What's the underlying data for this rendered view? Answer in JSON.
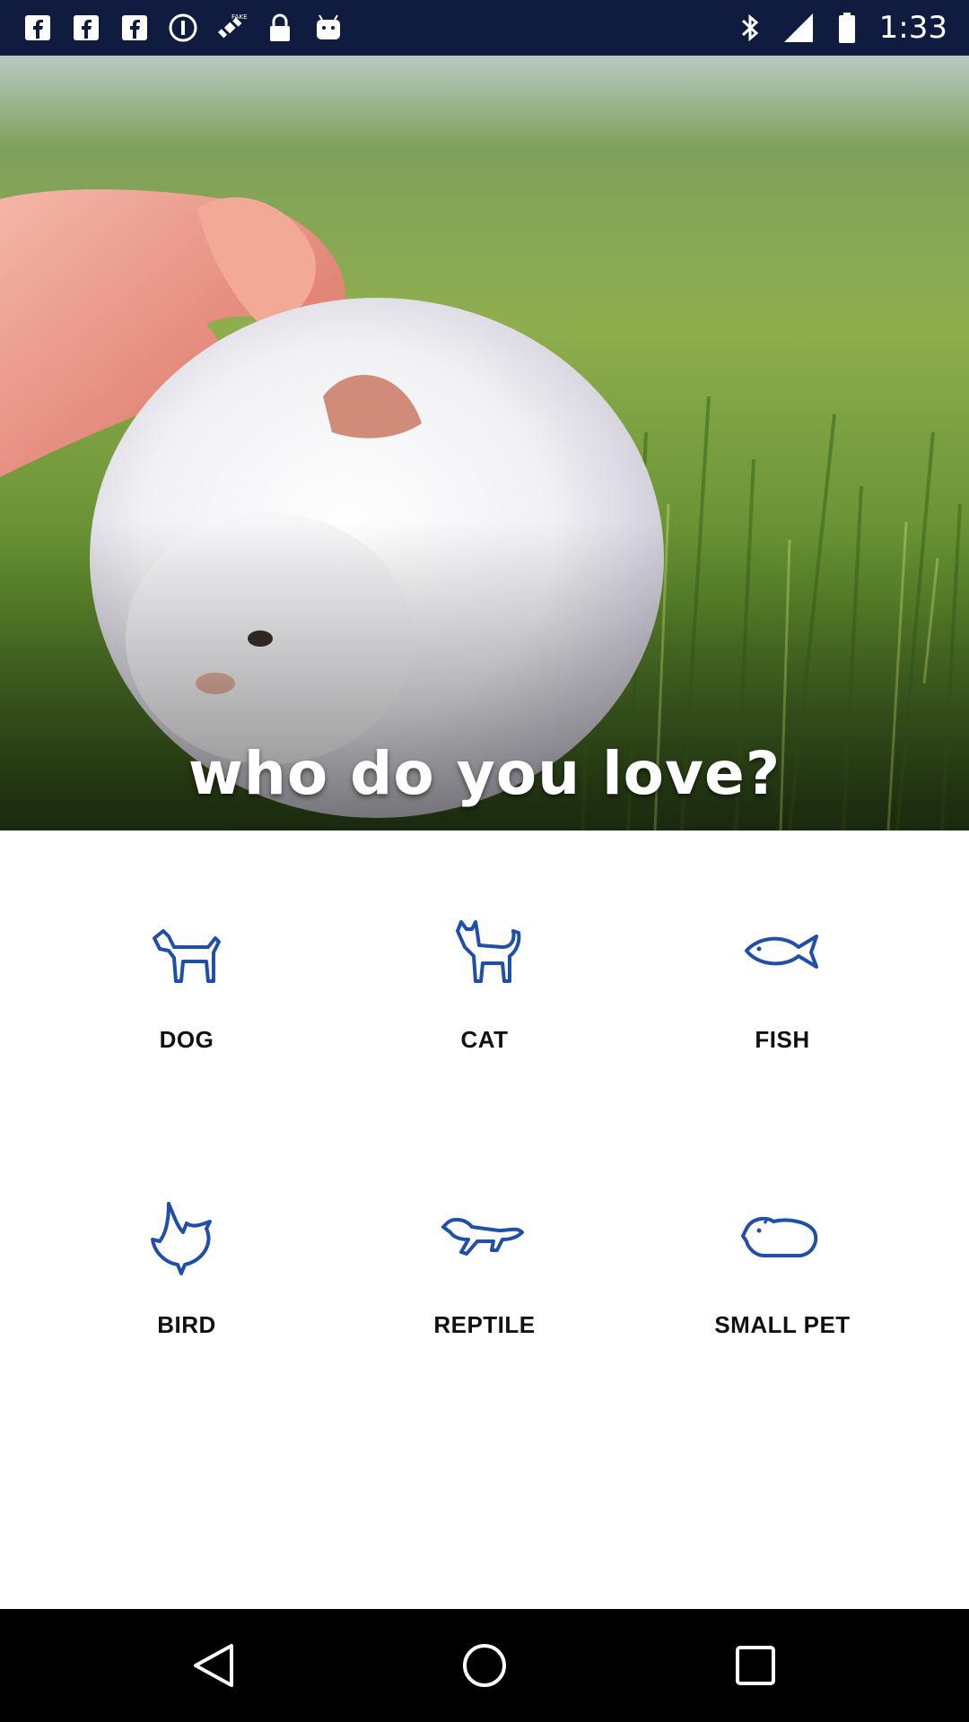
{
  "status_bar": {
    "time": "1:33",
    "icons_left": [
      "facebook-icon",
      "facebook-icon",
      "facebook-icon",
      "info-circle-icon",
      "fake-gps-satellite-icon",
      "lock-icon",
      "android-icon"
    ],
    "icons_right": [
      "bluetooth-icon"
    ]
  },
  "hero": {
    "title": "who do you love?"
  },
  "pets": [
    {
      "label": "DOG",
      "icon": "dog-icon"
    },
    {
      "label": "CAT",
      "icon": "cat-icon"
    },
    {
      "label": "FISH",
      "icon": "fish-icon"
    },
    {
      "label": "BIRD",
      "icon": "bird-icon"
    },
    {
      "label": "REPTILE",
      "icon": "reptile-icon"
    },
    {
      "label": "SMALL PET",
      "icon": "small-pet-icon"
    }
  ],
  "colors": {
    "status_bar_bg": "#0f1c3f",
    "icon_blue": "#1f4fa8",
    "text": "#111111"
  },
  "nav_bar": {
    "buttons": [
      "back-icon",
      "home-icon",
      "recents-icon"
    ]
  }
}
